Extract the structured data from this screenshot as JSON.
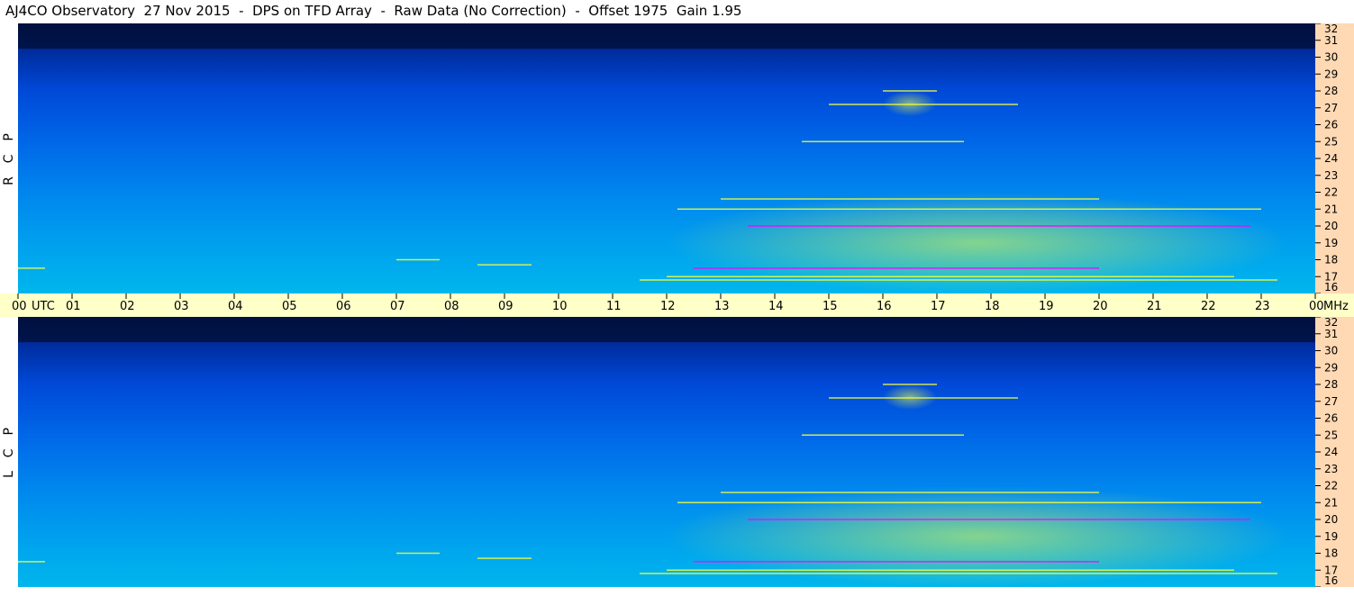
{
  "title": "AJ4CO Observatory  27 Nov 2015  -  DPS on TFD Array  -  Raw Data (No Correction)  -  Offset 1975  Gain 1.95",
  "panels": [
    {
      "polarization": "R  C  P"
    },
    {
      "polarization": "L  C  P"
    }
  ],
  "chart_data": {
    "type": "heatmap",
    "title": "AJ4CO Observatory  27 Nov 2015  -  DPS on TFD Array  -  Raw Data (No Correction)  -  Offset 1975  Gain 1.95",
    "x_axis": {
      "unit_label": "UTC",
      "range": [
        0,
        24
      ],
      "tick_labels": [
        "00",
        "01",
        "02",
        "03",
        "04",
        "05",
        "06",
        "07",
        "08",
        "09",
        "10",
        "11",
        "12",
        "13",
        "14",
        "15",
        "16",
        "17",
        "18",
        "19",
        "20",
        "21",
        "22",
        "23",
        "00"
      ]
    },
    "y_axis": {
      "unit_label": "MHz",
      "range": [
        16,
        32
      ],
      "tick_labels": [
        "32",
        "31",
        "30",
        "29",
        "28",
        "27",
        "26",
        "25",
        "24",
        "23",
        "22",
        "21",
        "20",
        "19",
        "18",
        "17",
        "16"
      ]
    },
    "series": [
      {
        "name": "R C P"
      },
      {
        "name": "L C P"
      }
    ],
    "features": [
      {
        "hours": [
          0,
          24
        ],
        "mhz": [
          30.5,
          32
        ],
        "level": "low"
      },
      {
        "hours": [
          12,
          23.5
        ],
        "mhz": [
          16,
          22
        ],
        "level": "high"
      },
      {
        "hours": [
          16,
          17
        ],
        "mhz": [
          26.5,
          28
        ],
        "level": "high"
      }
    ],
    "colors": {
      "low": "#00103e",
      "mid": "#0069e8",
      "high": "#f0ff40",
      "peak": "#ff00ff",
      "axis_bg": "#ffd9b3",
      "time_band_bg": "#ffffc8"
    }
  }
}
